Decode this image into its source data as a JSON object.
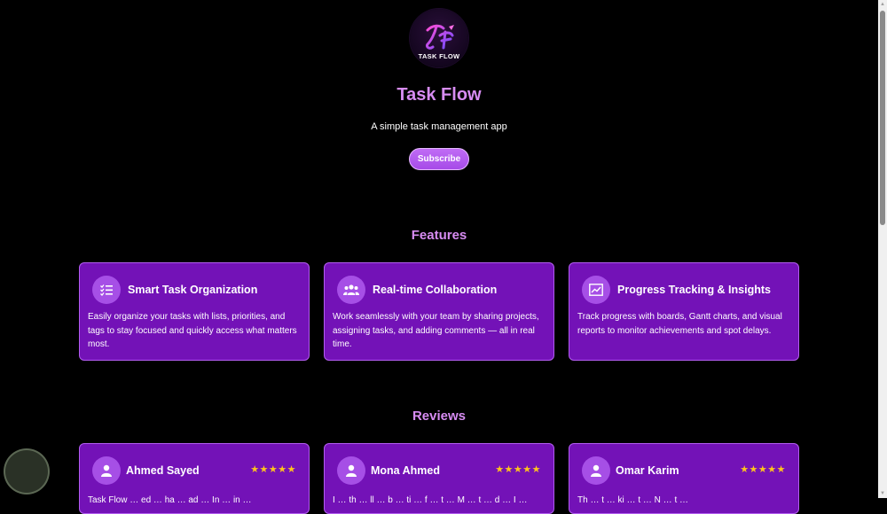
{
  "brand": {
    "logo_text": "TASK FLOW",
    "title": "Task Flow",
    "tagline": "A simple task management app",
    "subscribe_label": "Subscribe"
  },
  "features": {
    "heading": "Features",
    "items": [
      {
        "icon": "checklist-icon",
        "title": "Smart Task Organization",
        "description": "Easily organize your tasks with lists, priorities, and tags to stay focused and quickly access what matters most."
      },
      {
        "icon": "group-icon",
        "title": "Real-time Collaboration",
        "description": "Work seamlessly with your team by sharing projects, assigning tasks, and adding comments — all in real time."
      },
      {
        "icon": "chart-icon",
        "title": "Progress Tracking & Insights",
        "description": "Track progress with boards, Gantt charts, and visual reports to monitor achievements and spot delays."
      }
    ]
  },
  "reviews": {
    "heading": "Reviews",
    "items": [
      {
        "name": "Ahmed Sayed",
        "stars": "★★★★★",
        "rating": 5,
        "text": "Task Flow … ed … ha … ad … In … in …"
      },
      {
        "name": "Mona Ahmed",
        "stars": "★★★★★",
        "rating": 5,
        "text": "I … th … ll … b … ti … f … t … M … t … d … I …"
      },
      {
        "name": "Omar Karim",
        "stars": "★★★★★",
        "rating": 5,
        "text": "Th … t … ki … t … N … t …"
      }
    ]
  },
  "colors": {
    "background": "#000000",
    "accent": "#d78cf2",
    "card": "#7312b7",
    "star": "#ffc51d"
  }
}
